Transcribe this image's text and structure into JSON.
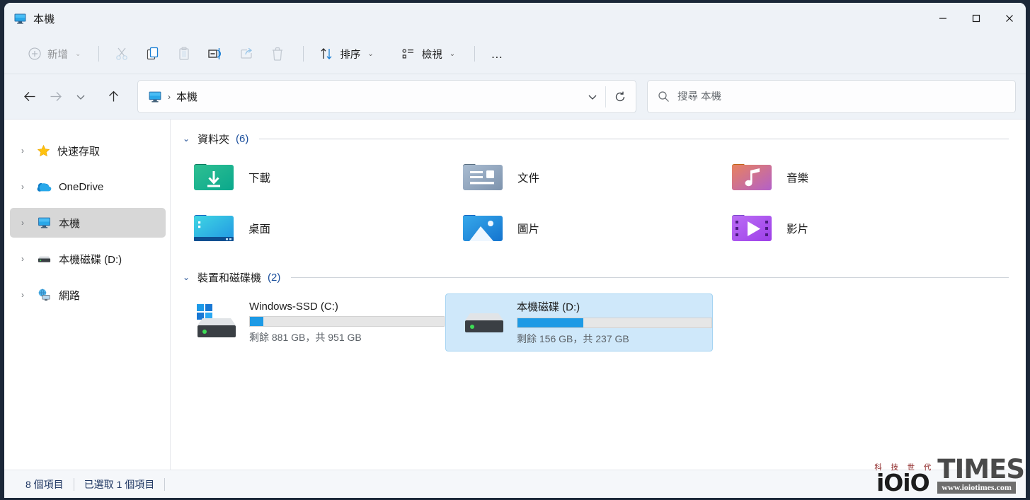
{
  "window": {
    "title": "本機",
    "title_icon": "this-pc-monitor-icon",
    "controls": {
      "minimize": "—",
      "maximize": "▢",
      "close": "✕"
    }
  },
  "toolbar": {
    "new_label": "新增",
    "cut_label": "剪下",
    "copy_label": "複製",
    "paste_label": "貼上",
    "rename_label": "重新命名",
    "share_label": "共用",
    "delete_label": "刪除",
    "sort_label": "排序",
    "view_label": "檢視",
    "more_label": "…"
  },
  "addressbar": {
    "back": "←",
    "forward": "→",
    "history": "⌄",
    "up": "↑",
    "breadcrumb_icon": "this-pc-monitor-icon",
    "breadcrumb_text": "本機",
    "breadcrumb_sep": "›",
    "dropdown": "⌄",
    "refresh": "⟳"
  },
  "search": {
    "placeholder": "搜尋 本機",
    "value": ""
  },
  "sidebar": {
    "items": [
      {
        "label": "快速存取",
        "icon": "star-icon",
        "selected": false
      },
      {
        "label": "OneDrive",
        "icon": "cloud-icon",
        "selected": false
      },
      {
        "label": "本機",
        "icon": "this-pc-monitor-icon",
        "selected": true
      },
      {
        "label": "本機磁碟 (D:)",
        "icon": "drive-icon",
        "selected": false
      },
      {
        "label": "網路",
        "icon": "network-icon",
        "selected": false
      }
    ]
  },
  "content": {
    "folders_group": {
      "title": "資料夾",
      "count": "(6)",
      "items": [
        {
          "label": "下載",
          "icon": "downloads-folder-icon"
        },
        {
          "label": "文件",
          "icon": "documents-folder-icon"
        },
        {
          "label": "音樂",
          "icon": "music-folder-icon"
        },
        {
          "label": "桌面",
          "icon": "desktop-folder-icon"
        },
        {
          "label": "圖片",
          "icon": "pictures-folder-icon"
        },
        {
          "label": "影片",
          "icon": "videos-folder-icon"
        }
      ]
    },
    "drives_group": {
      "title": "裝置和磁碟機",
      "count": "(2)",
      "items": [
        {
          "name": "Windows-SSD (C:)",
          "icon": "windows-drive-icon",
          "free": "881 GB",
          "total": "951 GB",
          "usage_text": "剩餘 881 GB，共 951 GB",
          "used_percent": 7,
          "selected": false
        },
        {
          "name": "本機磁碟 (D:)",
          "icon": "local-drive-icon",
          "free": "156 GB",
          "total": "237 GB",
          "usage_text": "剩餘 156 GB，共 237 GB",
          "used_percent": 34,
          "selected": true
        }
      ]
    }
  },
  "statusbar": {
    "item_count": "8 個項目",
    "selection": "已選取 1 個項目"
  },
  "watermark": {
    "cn": "科 技 世 代",
    "ioio": "iOiO",
    "times": "TIMES",
    "url": "www.ioiotimes.com"
  },
  "colors": {
    "accent": "#1d9ae5",
    "chrome": "#eef2f7",
    "selection": "#cfe8fa",
    "group_count": "#1b4f9c",
    "status_text": "#1f3763"
  }
}
